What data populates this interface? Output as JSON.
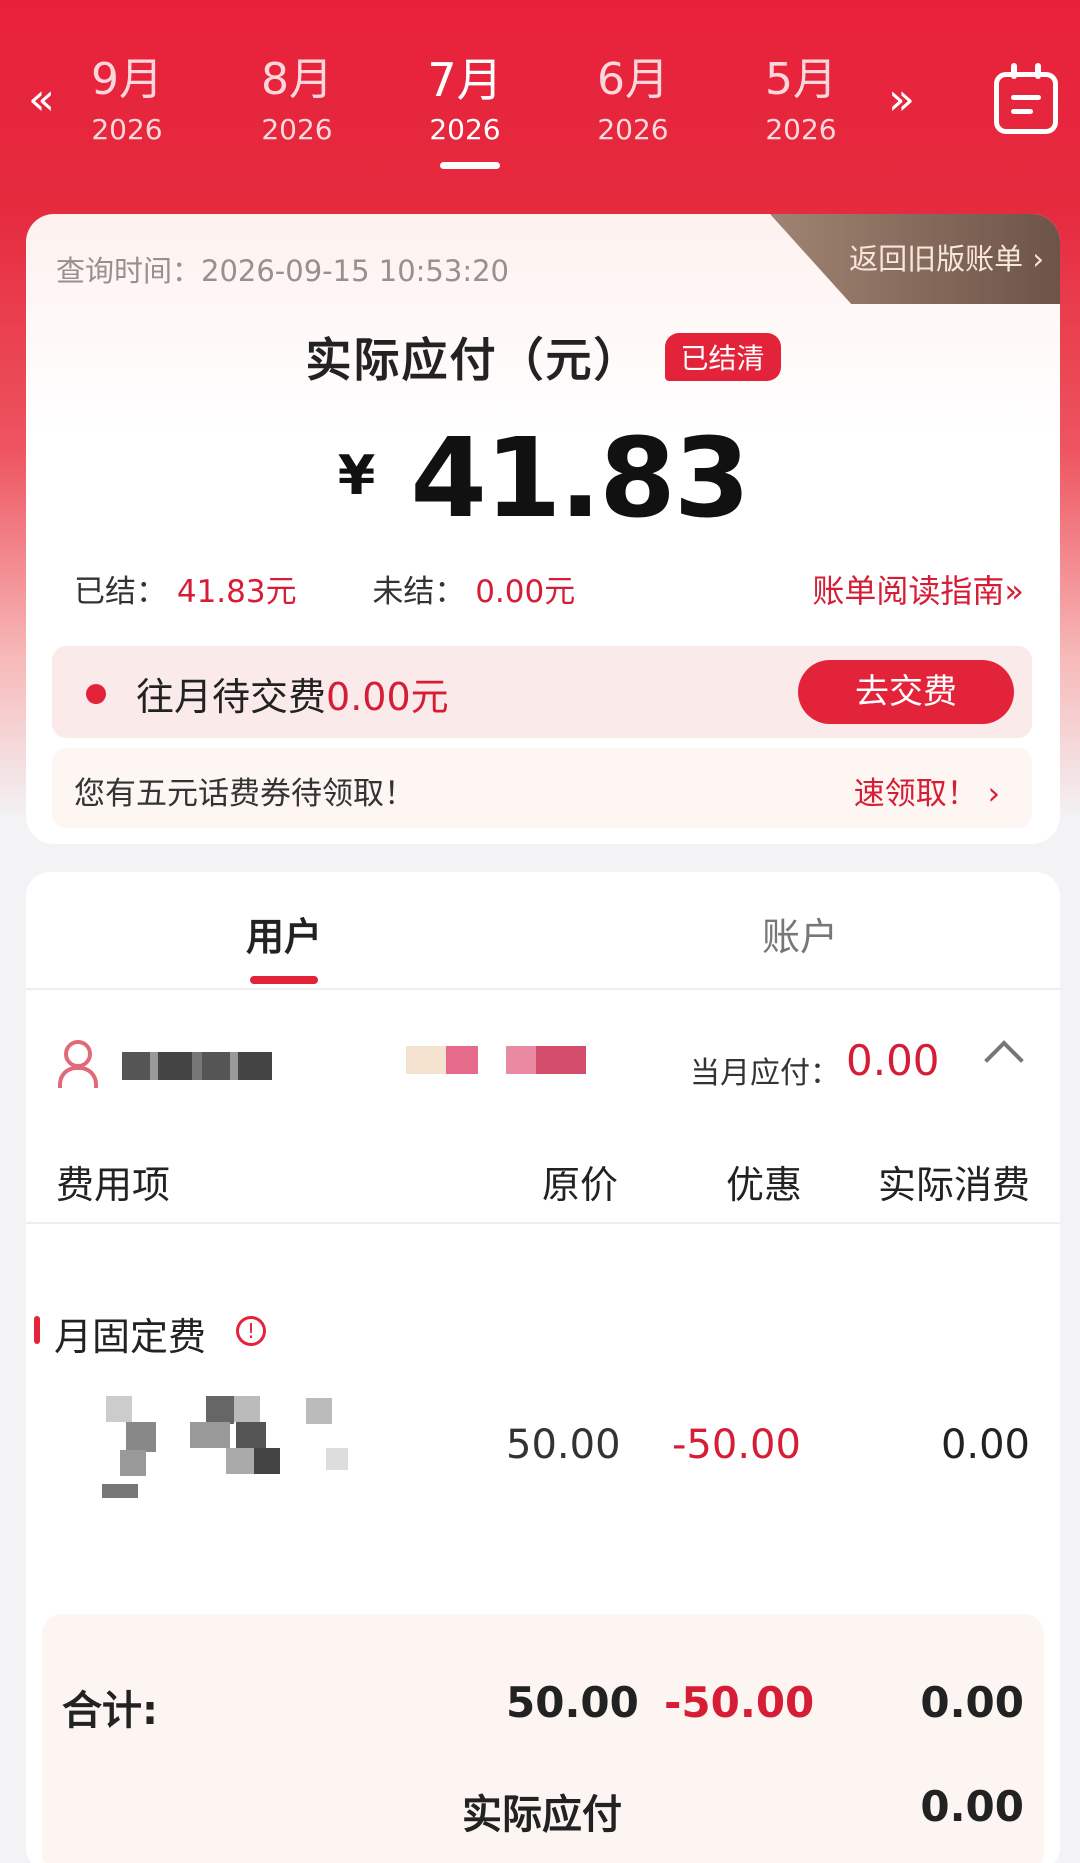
{
  "month_nav": {
    "prev_label": "«",
    "next_label": "»",
    "months": [
      {
        "month": "9月",
        "year": "2026",
        "active": false
      },
      {
        "month": "8月",
        "year": "2026",
        "active": false
      },
      {
        "month": "7月",
        "year": "2026",
        "active": true
      },
      {
        "month": "6月",
        "year": "2026",
        "active": false
      },
      {
        "month": "5月",
        "year": "2026",
        "active": false
      }
    ],
    "calendar_icon": "calendar-icon"
  },
  "summary": {
    "query_time": "查询时间：2026-09-15 10:53:20",
    "old_bill_link": "返回旧版账单 ›",
    "amount_title": "实际应付（元）",
    "status_badge": "已结清",
    "currency": "¥",
    "amount": "41.83",
    "settled_label": "已结：",
    "settled_value": "41.83元",
    "unsettled_label": "未结：",
    "unsettled_value": "0.00元",
    "guide_link": "账单阅读指南»",
    "pending_label": "往月待交费",
    "pending_value": "0.00元",
    "pay_button": "去交费",
    "coupon_text": "您有五元话费券待领取！",
    "coupon_link": "速领取！ ›"
  },
  "tabs": {
    "user": "用户",
    "account": "账户"
  },
  "user_row": {
    "monthly_label": "当月应付：",
    "monthly_value": "0.00"
  },
  "table": {
    "headers": {
      "item": "费用项",
      "original": "原价",
      "discount": "优惠",
      "actual": "实际消费"
    },
    "section_title": "月固定费",
    "rows": [
      {
        "original": "50.00",
        "discount": "-50.00",
        "actual": "0.00"
      }
    ],
    "total": {
      "label": "合计:",
      "original": "50.00",
      "discount": "-50.00",
      "actual": "0.00"
    },
    "payable": {
      "label": "实际应付",
      "value": "0.00"
    }
  },
  "colors": {
    "brand_red": "#e3233a",
    "accent_red_text": "#d61d36"
  }
}
